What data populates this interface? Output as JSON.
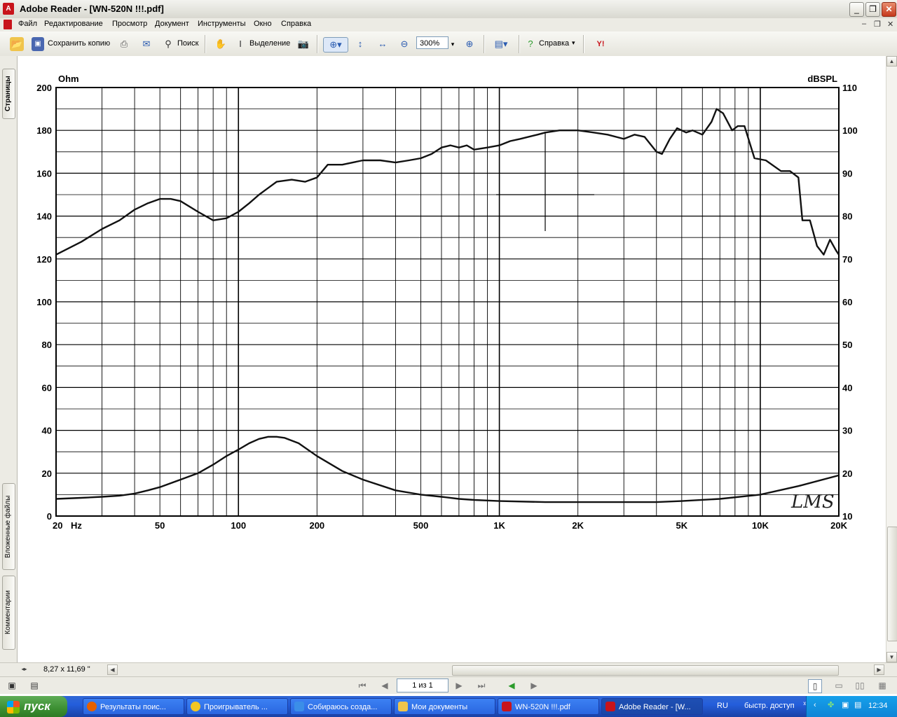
{
  "window": {
    "title": "Adobe Reader - [WN-520N !!!.pdf]",
    "app_icon": "adobe-reader-icon"
  },
  "menu": [
    "Файл",
    "Редактирование",
    "Просмотр",
    "Документ",
    "Инструменты",
    "Окно",
    "Справка"
  ],
  "toolbar": {
    "save_copy": "Сохранить копию",
    "search": "Поиск",
    "select": "Выделение",
    "zoom": "300%",
    "help": "Справка"
  },
  "side_tabs": {
    "pages": "Страницы",
    "attachments": "Вложенные файлы",
    "comments": "Комментарии"
  },
  "chart_data": {
    "type": "line",
    "xlabel": "Hz",
    "ylabel_left": "Ohm",
    "ylabel_right": "dBSPL",
    "x_scale": "log",
    "xlim": [
      20,
      20000
    ],
    "ylim_left": [
      0,
      200
    ],
    "ylim_right": [
      10,
      110
    ],
    "x_tick_labels": [
      "20",
      "50",
      "100",
      "200",
      "500",
      "1K",
      "2K",
      "5K",
      "10K",
      "20K"
    ],
    "x_tick_values": [
      20,
      50,
      100,
      200,
      500,
      1000,
      2000,
      5000,
      10000,
      20000
    ],
    "y_left_ticks": [
      0,
      20,
      40,
      60,
      80,
      100,
      120,
      140,
      160,
      180,
      200
    ],
    "y_right_ticks": [
      10,
      20,
      30,
      40,
      50,
      60,
      70,
      80,
      90,
      100,
      110
    ],
    "grid": true,
    "watermark": "LMS",
    "series": [
      {
        "axis": "right",
        "x": [
          20,
          25,
          30,
          35,
          40,
          45,
          50,
          55,
          60,
          70,
          80,
          90,
          100,
          110,
          120,
          140,
          160,
          180,
          200,
          220,
          250,
          300,
          350,
          400,
          450,
          500,
          550,
          600,
          650,
          700,
          750,
          800,
          900,
          1000,
          1100,
          1200,
          1400,
          1500,
          1700,
          2000,
          2300,
          2600,
          3000,
          3300,
          3600,
          4000,
          4200,
          4500,
          4800,
          5200,
          5500,
          6000,
          6500,
          6800,
          7200,
          7800,
          8200,
          8700,
          9500,
          10500,
          12000,
          13000,
          14000,
          14500,
          15500,
          16500,
          17500,
          18500,
          19500,
          20000
        ],
        "y": [
          71,
          74,
          77,
          79,
          81.5,
          83,
          84,
          84,
          83.5,
          81,
          79,
          79.5,
          81,
          83,
          85,
          88,
          88.5,
          88,
          89,
          92,
          92,
          93,
          93,
          92.5,
          93,
          93.5,
          94.5,
          96,
          96.5,
          96,
          96.5,
          95.5,
          96,
          96.5,
          97.5,
          98,
          99,
          99.5,
          100,
          100,
          99.5,
          99,
          98,
          99,
          98.5,
          95,
          94.5,
          98,
          100.5,
          99.5,
          100,
          99,
          102,
          105,
          104,
          100,
          101,
          101,
          93.5,
          93,
          90.5,
          90.5,
          89,
          79,
          79,
          73,
          71,
          74.5,
          72,
          71
        ]
      },
      {
        "axis": "left",
        "x": [
          20,
          25,
          30,
          35,
          40,
          45,
          50,
          60,
          70,
          80,
          90,
          100,
          110,
          120,
          130,
          140,
          150,
          170,
          200,
          250,
          300,
          400,
          500,
          600,
          700,
          800,
          1000,
          1500,
          2000,
          3000,
          4000,
          5000,
          7000,
          10000,
          14000,
          20000
        ],
        "y": [
          8,
          8.5,
          9,
          9.5,
          10.5,
          12,
          13.5,
          17,
          20,
          24,
          28,
          31,
          34,
          36,
          37,
          37,
          36.5,
          34,
          28,
          21,
          17,
          12,
          10,
          9,
          8,
          7.5,
          7,
          6.5,
          6.5,
          6.5,
          6.5,
          7,
          8,
          10,
          14,
          19
        ]
      }
    ]
  },
  "status": {
    "page_size": "8,27 x 11,69 \"",
    "page_indicator": "1 из 1"
  },
  "taskbar": {
    "start": "пуск",
    "tasks": [
      "Результаты поис...",
      "Проигрыватель ...",
      "Собираюсь созда...",
      "Мои документы",
      "WN-520N !!!.pdf",
      "Adobe Reader - [W..."
    ],
    "lang": "RU",
    "quick": "быстр. доступ",
    "clock": "12:34"
  }
}
